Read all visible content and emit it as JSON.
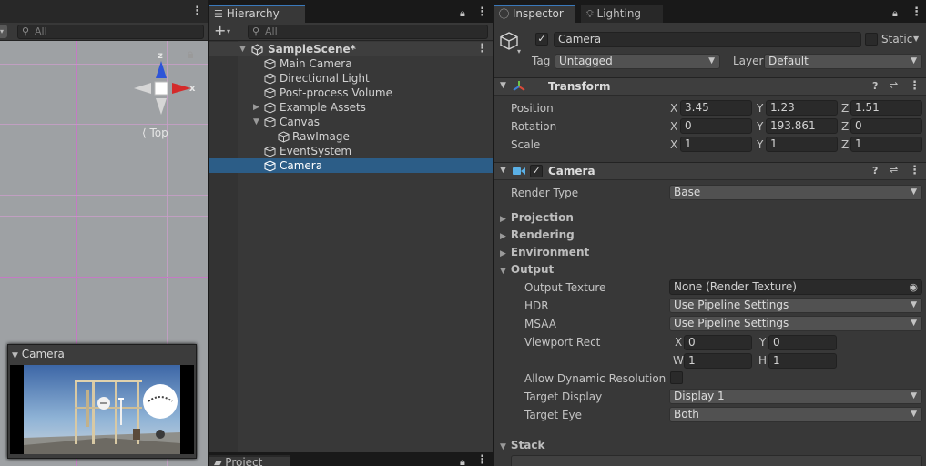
{
  "scene": {
    "search_placeholder": "All",
    "gizmo": {
      "y_axis": "z",
      "x_axis": "x",
      "view_label": "Top"
    },
    "camera_preview_title": "Camera"
  },
  "hierarchy": {
    "tab": "Hierarchy",
    "add_label": "+",
    "search_placeholder": "All",
    "items": [
      {
        "label": "SampleScene*",
        "kind": "scene",
        "expanded": true
      },
      {
        "label": "Main Camera"
      },
      {
        "label": "Directional Light"
      },
      {
        "label": "Post-process Volume"
      },
      {
        "label": "Example Assets",
        "collapsed": true
      },
      {
        "label": "Canvas",
        "expanded": true
      },
      {
        "label": "RawImage"
      },
      {
        "label": "EventSystem"
      },
      {
        "label": "Camera",
        "selected": true
      }
    ],
    "project_tab": "Project"
  },
  "inspector": {
    "tabs": {
      "inspector": "Inspector",
      "lighting": "Lighting"
    },
    "object_name": "Camera",
    "active_check": "✓",
    "static_label": "Static",
    "tag_label": "Tag",
    "tag_value": "Untagged",
    "layer_label": "Layer",
    "layer_value": "Default",
    "transform": {
      "title": "Transform",
      "position_label": "Position",
      "position": {
        "x": "3.45",
        "y": "1.23",
        "z": "1.51"
      },
      "rotation_label": "Rotation",
      "rotation": {
        "x": "0",
        "y": "193.861",
        "z": "0"
      },
      "scale_label": "Scale",
      "scale": {
        "x": "1",
        "y": "1",
        "z": "1"
      }
    },
    "axis": {
      "x": "X",
      "y": "Y",
      "z": "Z",
      "w": "W",
      "h": "H"
    },
    "camera": {
      "title": "Camera",
      "enabled_check": "✓",
      "render_type_label": "Render Type",
      "render_type_value": "Base",
      "sections": {
        "projection": "Projection",
        "rendering": "Rendering",
        "environment": "Environment",
        "output": "Output",
        "stack": "Stack"
      },
      "output_texture_label": "Output Texture",
      "output_texture_value": "None (Render Texture)",
      "hdr_label": "HDR",
      "hdr_value": "Use Pipeline Settings",
      "msaa_label": "MSAA",
      "msaa_value": "Use Pipeline Settings",
      "viewport_label": "Viewport Rect",
      "viewport": {
        "x": "0",
        "y": "0",
        "w": "1",
        "h": "1"
      },
      "dynamic_res_label": "Allow Dynamic Resolution",
      "target_display_label": "Target Display",
      "target_display_value": "Display 1",
      "target_eye_label": "Target Eye",
      "target_eye_value": "Both"
    }
  },
  "colors": {
    "accent": "#3a79bb",
    "selection": "#2c5d87",
    "grid": "#c47bc4",
    "panel": "#383838"
  }
}
